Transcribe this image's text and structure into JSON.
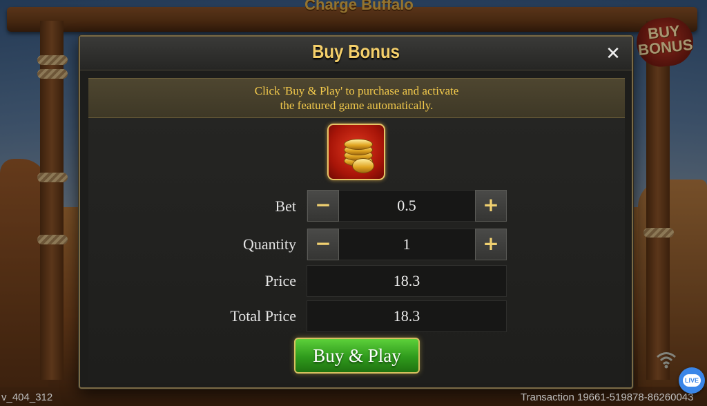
{
  "background": {
    "game_title": "Charge Buffalo",
    "buy_badge_line1": "BUY",
    "buy_badge_line2": "BONUS"
  },
  "dialog": {
    "title": "Buy Bonus",
    "close_icon": "close-icon",
    "notice_line1": "Click 'Buy & Play' to purchase and activate",
    "notice_line2": "the featured game automatically.",
    "feature_icon": "gold-coins-icon",
    "bet": {
      "label": "Bet",
      "value": "0.5",
      "decrease": "−",
      "increase": "+"
    },
    "quantity": {
      "label": "Quantity",
      "value": "1",
      "decrease": "−",
      "increase": "+"
    },
    "price": {
      "label": "Price",
      "value": "18.3"
    },
    "total_price": {
      "label": "Total Price",
      "value": "18.3"
    },
    "buy_button": "Buy & Play"
  },
  "footer": {
    "version": "v_404_312",
    "transaction": "Transaction 19661-519878-86260043"
  },
  "live_chat": {
    "label": "LIVE"
  },
  "colors": {
    "title_gold": "#f4cf6a",
    "notice_text": "#f2c94c",
    "buy_green": "#2f9a1c",
    "live_blue": "#3a86e8"
  }
}
